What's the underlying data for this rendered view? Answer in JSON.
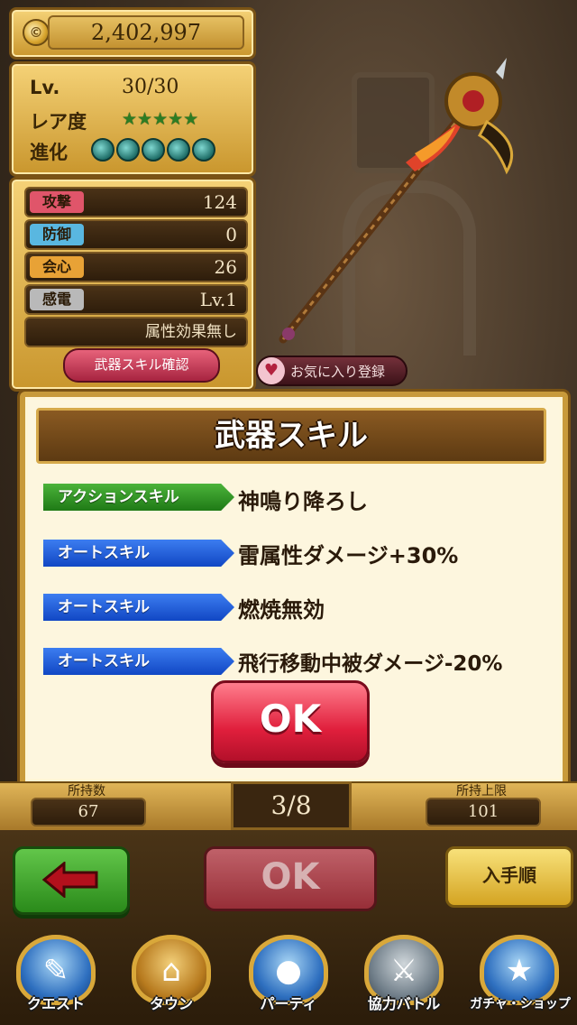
{
  "header": {
    "coins": "2,402,997",
    "coin_icon": "coin-icon",
    "coin_symbol": "©"
  },
  "info": {
    "level_label": "Lv.",
    "level_value": "30/30",
    "rarity_label": "レア度",
    "rarity_stars": "★★★★★",
    "rarity_count": 5,
    "evolution_label": "進化",
    "evolution_count": 5
  },
  "stats": [
    {
      "label": "攻撃",
      "value": "124",
      "color": "#e0556a"
    },
    {
      "label": "防御",
      "value": "0",
      "color": "#59b7e0"
    },
    {
      "label": "会心",
      "value": "26",
      "color": "#e8a236"
    },
    {
      "label": "感電",
      "value": "Lv.1",
      "color": "#b9b9b9"
    }
  ],
  "attribute_note": "属性効果無し",
  "skill_check_button": "武器スキル確認",
  "favorite_button": "お気に入り登録",
  "modal": {
    "title": "武器スキル",
    "skills": [
      {
        "type": "アクションスキル",
        "name": "神鳴り降ろし",
        "color": "green"
      },
      {
        "type": "オートスキル",
        "name": "雷属性ダメージ+30%",
        "color": "blue"
      },
      {
        "type": "オートスキル",
        "name": "燃焼無効",
        "color": "blue"
      },
      {
        "type": "オートスキル",
        "name": "飛行移動中被ダメージ-20%",
        "color": "blue"
      }
    ],
    "ok_label": "OK"
  },
  "counter": {
    "owned_label": "所持数",
    "owned_value": "67",
    "page": "3/8",
    "limit_label": "所持上限",
    "limit_value": "101"
  },
  "actions": {
    "back_icon": "arrow-left-icon",
    "ok_label": "OK",
    "sort_label": "入手順"
  },
  "nav": [
    {
      "label": "クエスト",
      "icon": "quest-map-icon"
    },
    {
      "label": "タウン",
      "icon": "town-icon"
    },
    {
      "label": "パーティ",
      "icon": "party-icon"
    },
    {
      "label": "協力バトル",
      "icon": "coop-battle-icon"
    },
    {
      "label": "ガチャ・ショップ",
      "icon": "gacha-star-icon"
    }
  ]
}
